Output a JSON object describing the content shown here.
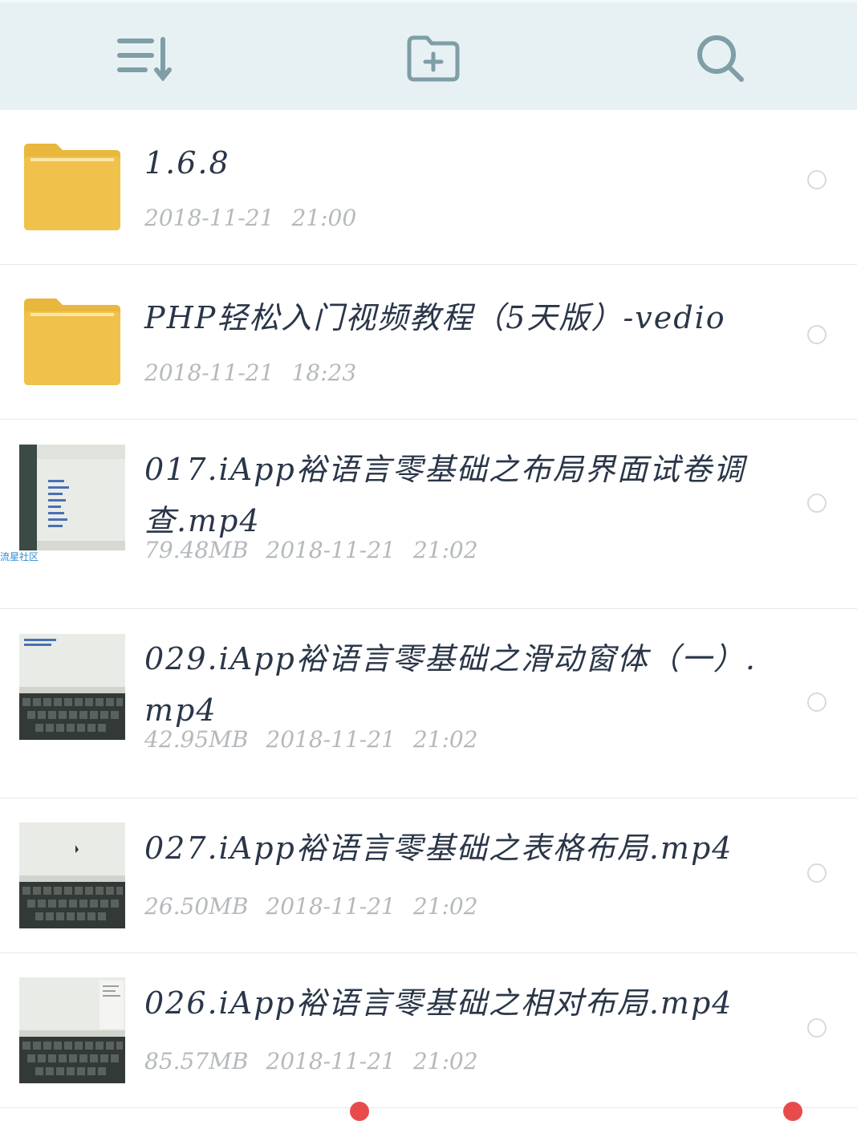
{
  "toolbar": {
    "sort_icon": "sort-list-icon",
    "new_folder_icon": "folder-plus-icon",
    "search_icon": "search-icon",
    "icon_color": "#7f9ea6"
  },
  "watermark": "流星社区",
  "items": [
    {
      "type": "folder",
      "name": "1.6.8",
      "date": "2018-11-21",
      "time": "21:00"
    },
    {
      "type": "folder",
      "name": "PHP轻松入门视频教程（5天版）-vedio",
      "date": "2018-11-21",
      "time": "18:23"
    },
    {
      "type": "video",
      "name": "017.iApp裕语言零基础之布局界面试卷调查.mp4",
      "size": "79.48MB",
      "date": "2018-11-21",
      "time": "21:02"
    },
    {
      "type": "video",
      "name": "029.iApp裕语言零基础之滑动窗体（一）.mp4",
      "size": "42.95MB",
      "date": "2018-11-21",
      "time": "21:02"
    },
    {
      "type": "video",
      "name": "027.iApp裕语言零基础之表格布局.mp4",
      "size": "26.50MB",
      "date": "2018-11-21",
      "time": "21:02"
    },
    {
      "type": "video",
      "name": "026.iApp裕语言零基础之相对布局.mp4",
      "size": "85.57MB",
      "date": "2018-11-21",
      "time": "21:02"
    }
  ],
  "colors": {
    "folder": "#f0c24b",
    "folder_tab": "#e9b73d",
    "text": "#2a3648",
    "meta": "#b5b9bc",
    "toolbar_bg": "#e7f1f4",
    "badge": "#e84b4b"
  }
}
